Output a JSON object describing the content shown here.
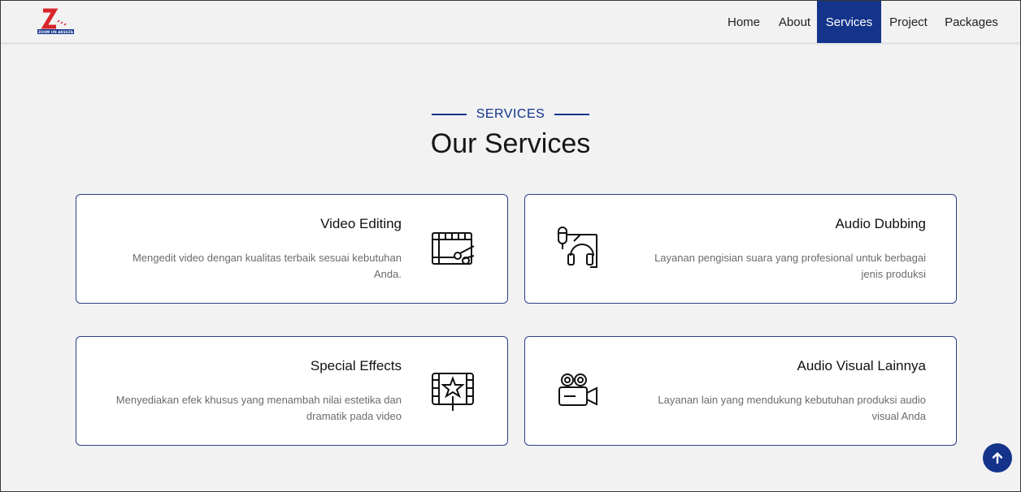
{
  "colors": {
    "brand": "#13348a",
    "logo_red": "#d8262b",
    "background": "#f2f2f3"
  },
  "logo": {
    "letter": "Z",
    "tagline": "ZOOM UN AKSILTA",
    "icon": "zoom-logo"
  },
  "nav": {
    "items": [
      {
        "label": "Home"
      },
      {
        "label": "About"
      },
      {
        "label": "Services",
        "active": true
      },
      {
        "label": "Project"
      },
      {
        "label": "Packages"
      }
    ]
  },
  "section": {
    "label": "SERVICES",
    "title": "Our Services"
  },
  "services": [
    {
      "title": "Video Editing",
      "description": "Mengedit video dengan kualitas terbaik sesuai kebutuhan Anda.",
      "icon": "video-editing-icon"
    },
    {
      "title": "Audio Dubbing",
      "description": "Layanan pengisian suara yang profesional untuk berbagai jenis produksi",
      "icon": "audio-dubbing-icon"
    },
    {
      "title": "Special Effects",
      "description": "Menyediakan efek khusus yang menambah nilai estetika dan dramatik pada video",
      "icon": "special-effects-icon"
    },
    {
      "title": "Audio Visual Lainnya",
      "description": "Layanan lain yang mendukung kebutuhan produksi audio visual Anda",
      "icon": "movie-camera-icon"
    }
  ],
  "scroll_top": {
    "icon": "arrow-up-icon"
  }
}
